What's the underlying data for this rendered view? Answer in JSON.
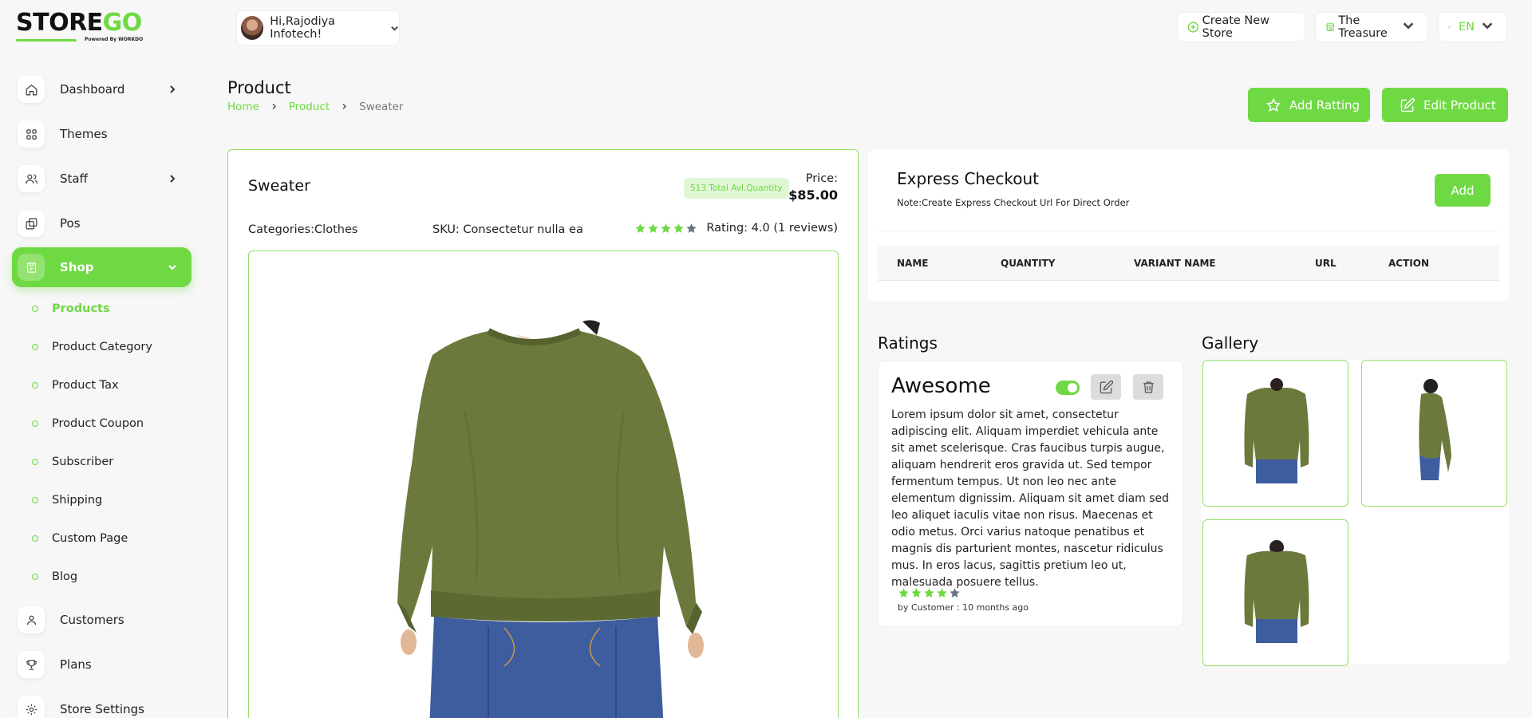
{
  "brand": {
    "name_left": "STORE",
    "name_right": "GO",
    "powered_by": "Powered By WORKDO"
  },
  "colors": {
    "accent": "#6fd943",
    "accent_soft": "#dff7d5",
    "sweater": "#6b7a3c",
    "jeans": "#3d5d9e"
  },
  "sidebar": {
    "items": [
      {
        "label": "Dashboard",
        "icon": "home-icon",
        "has_chevron": true
      },
      {
        "label": "Themes",
        "icon": "grid-icon",
        "has_chevron": false
      },
      {
        "label": "Staff",
        "icon": "users-icon",
        "has_chevron": true
      },
      {
        "label": "Pos",
        "icon": "layers-icon",
        "has_chevron": false
      },
      {
        "label": "Shop",
        "icon": "shop-icon",
        "has_chevron": true,
        "active": true
      },
      {
        "label": "Customers",
        "icon": "user-icon",
        "has_chevron": false
      },
      {
        "label": "Plans",
        "icon": "trophy-icon",
        "has_chevron": false
      },
      {
        "label": "Store Settings",
        "icon": "settings-icon",
        "has_chevron": false
      }
    ],
    "sub_items": [
      {
        "label": "Products",
        "current": true
      },
      {
        "label": "Product Category"
      },
      {
        "label": "Product Tax"
      },
      {
        "label": "Product Coupon"
      },
      {
        "label": "Subscriber"
      },
      {
        "label": "Shipping"
      },
      {
        "label": "Custom Page"
      },
      {
        "label": "Blog"
      }
    ]
  },
  "header": {
    "greeting": "Hi,Rajodiya Infotech!",
    "create_store": "Create New Store",
    "store_name": "The Treasure",
    "language": "EN"
  },
  "page": {
    "title": "Product",
    "breadcrumb": [
      "Home",
      "Product",
      "Sweater"
    ],
    "add_rating_label": "Add Ratting",
    "edit_product_label": "Edit Product"
  },
  "product": {
    "name": "Sweater",
    "quantity_badge": "513 Total Avl.Quantity",
    "price_label": "Price:",
    "price": "$85.00",
    "categories": "Categories:Clothes",
    "sku": "SKU: Consectetur nulla ea",
    "rating_value": 4,
    "rating_text": "Rating: 4.0 (1 reviews)"
  },
  "express_checkout": {
    "title": "Express Checkout",
    "note": "Note:Create Express Checkout Url For Direct Order",
    "add_label": "Add",
    "columns": [
      "NAME",
      "QUANTITY",
      "VARIANT NAME",
      "URL",
      "ACTION"
    ]
  },
  "ratings": {
    "section_title": "Ratings",
    "items": [
      {
        "title": "Awesome",
        "enabled": true,
        "body": "Lorem ipsum dolor sit amet, consectetur adipiscing elit. Aliquam imperdiet vehicula ante sit amet scelerisque. Cras faucibus turpis augue, aliquam hendrerit eros gravida ut. Sed tempor fermentum tempus. Ut non leo nec ante elementum dignissim. Aliquam sit amet diam sed leo aliquet iaculis vitae non risus. Maecenas et odio metus. Orci varius natoque penatibus et magnis dis parturient montes, nascetur ridiculus mus. In eros lacus, sagittis pretium leo ut, malesuada posuere tellus.",
        "stars": 4,
        "by": "by Customer : 10 months ago"
      }
    ]
  },
  "gallery": {
    "section_title": "Gallery",
    "images": [
      "sweater-front-image",
      "sweater-side-image",
      "sweater-back-image"
    ]
  }
}
